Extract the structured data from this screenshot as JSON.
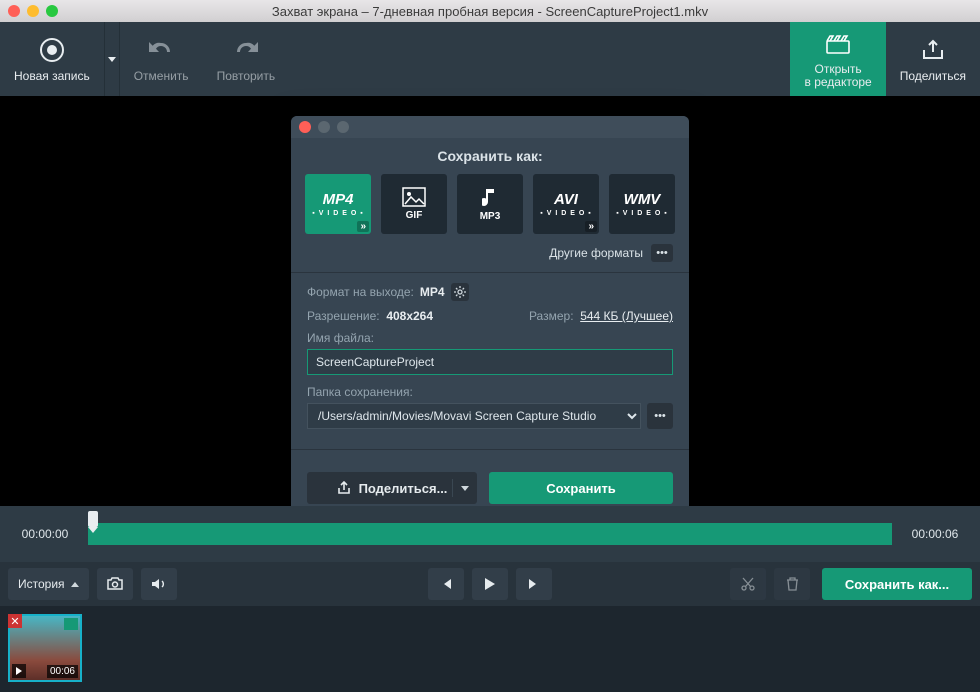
{
  "window": {
    "title": "Захват экрана – 7-дневная пробная версия - ScreenCaptureProject1.mkv"
  },
  "toolbar": {
    "new_record": "Новая запись",
    "undo": "Отменить",
    "redo": "Повторить",
    "open_editor_l1": "Открыть",
    "open_editor_l2": "в редакторе",
    "share": "Поделиться"
  },
  "dialog": {
    "title": "Сохранить как:",
    "formats": [
      "MP4",
      "GIF",
      "MP3",
      "AVI",
      "WMV"
    ],
    "other_formats": "Другие форматы",
    "output_label": "Формат на выходе:",
    "output_value": "MP4",
    "resolution_label": "Разрешение:",
    "resolution_value": "408x264",
    "size_label": "Размер:",
    "size_value": "544 КБ (Лучшее)",
    "filename_label": "Имя файла:",
    "filename_value": "ScreenCaptureProject",
    "folder_label": "Папка сохранения:",
    "folder_value": "/Users/admin/Movies/Movavi Screen Capture Studio",
    "share_btn": "Поделиться...",
    "save_btn": "Сохранить"
  },
  "timeline": {
    "start": "00:00:00",
    "end": "00:00:06"
  },
  "controls": {
    "history": "История",
    "save_as": "Сохранить как..."
  },
  "thumb": {
    "duration": "00:06"
  }
}
